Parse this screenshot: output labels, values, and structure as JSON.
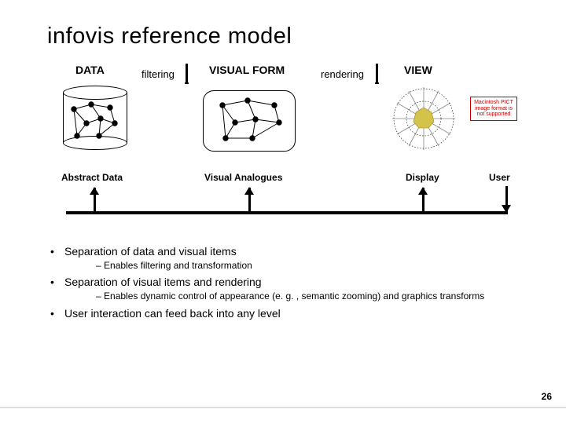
{
  "title": "infovis reference model",
  "stages": {
    "data": {
      "header": "DATA",
      "footer": "Abstract Data"
    },
    "visual": {
      "header": "VISUAL FORM",
      "footer": "Visual Analogues"
    },
    "view": {
      "header": "VIEW",
      "footer": "Display"
    }
  },
  "arrows": {
    "filtering": "filtering",
    "rendering": "rendering"
  },
  "user_label": "User",
  "bullets": [
    {
      "text": "Separation of data and visual items",
      "sub": [
        "Enables filtering and transformation"
      ]
    },
    {
      "text": "Separation of visual items and rendering",
      "sub": [
        "Enables dynamic control of appearance (e. g. , semantic zooming) and graphics transforms"
      ]
    },
    {
      "text": "User interaction can feed back into any level",
      "sub": []
    }
  ],
  "page_number": "26",
  "pict_error": "Macintosh PICT image format is not supported"
}
